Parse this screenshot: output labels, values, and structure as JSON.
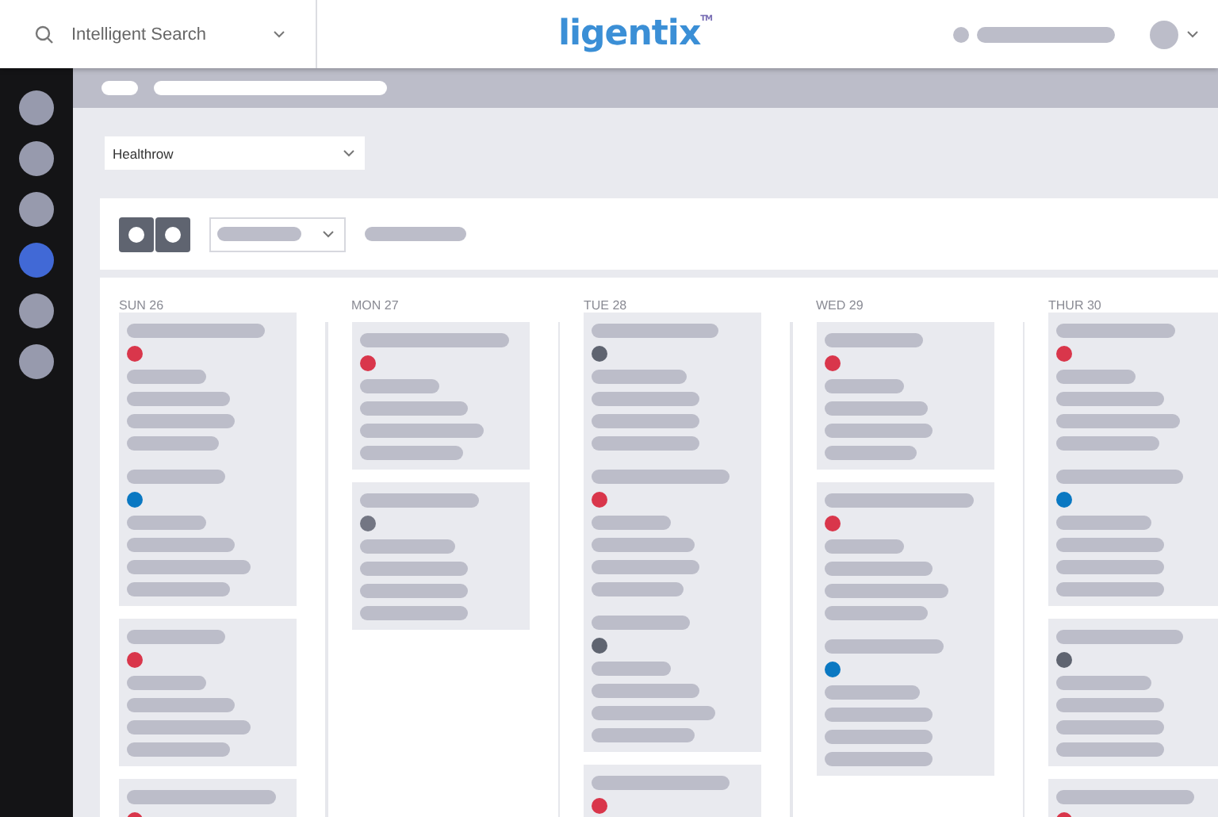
{
  "header": {
    "search": {
      "placeholder": "Intelligent Search"
    },
    "logo": "ligentix$^{TM}$"
  },
  "sidebar": {
    "items": [
      {
        "selected": false
      },
      {
        "selected": false
      },
      {
        "selected": false
      },
      {
        "selected": true
      },
      {
        "selected": false
      },
      {
        "selected": false
      }
    ]
  },
  "location_dropdown": {
    "value": "Healthrow"
  },
  "calendar": {
    "days": [
      {
        "label": "SUN 26",
        "cards": [
          {
            "events": [
              {
                "color": "#d9364b"
              },
              {
                "color": "#0a78c2"
              }
            ]
          },
          {
            "events": [
              {
                "color": "#d9364b"
              }
            ]
          },
          {
            "events": [
              {
                "color": "#d9364b"
              }
            ]
          }
        ]
      },
      {
        "label": "MON 27",
        "cards": [
          {
            "events": [
              {
                "color": "#d9364b"
              }
            ]
          },
          {
            "events": [
              {
                "color": "#737683"
              }
            ]
          }
        ]
      },
      {
        "label": "TUE 28",
        "cards": [
          {
            "events": [
              {
                "color": "#5f6470"
              },
              {
                "color": "#d9364b"
              },
              {
                "color": "#5f6470"
              }
            ]
          },
          {
            "events": [
              {
                "color": "#d9364b"
              }
            ]
          }
        ]
      },
      {
        "label": "WED 29",
        "cards": [
          {
            "events": [
              {
                "color": "#d9364b"
              }
            ]
          },
          {
            "events": [
              {
                "color": "#d9364b"
              },
              {
                "color": "#0a78c2"
              }
            ]
          }
        ]
      },
      {
        "label": "THUR 30",
        "cards": [
          {
            "events": [
              {
                "color": "#d9364b"
              },
              {
                "color": "#0a78c2"
              }
            ]
          },
          {
            "events": [
              {
                "color": "#5f6470"
              }
            ]
          },
          {
            "events": [
              {
                "color": "#d9364b"
              }
            ]
          }
        ]
      }
    ]
  }
}
